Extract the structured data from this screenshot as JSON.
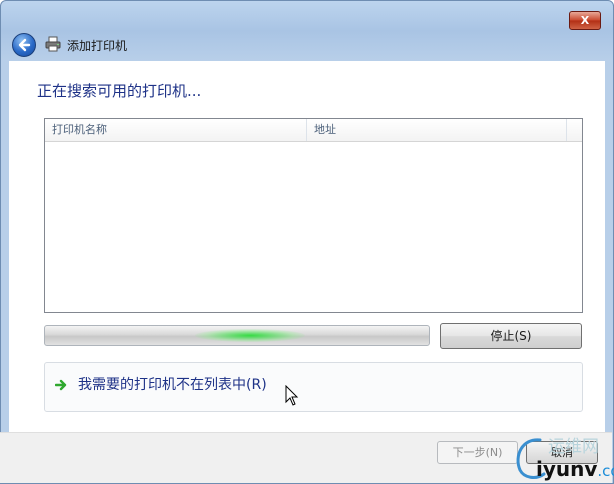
{
  "window": {
    "title": "添加打印机",
    "close_label": "X"
  },
  "main": {
    "heading": "正在搜索可用的打印机...",
    "list": {
      "columns": [
        "打印机名称",
        "地址"
      ],
      "rows": []
    },
    "progress": {
      "state": "indeterminate"
    },
    "stop_label": "停止(S)",
    "missing_printer_link": "我需要的打印机不在列表中(R)"
  },
  "footer": {
    "next_label": "下一步(N)",
    "cancel_label": "取消"
  },
  "watermark": {
    "line1": "运维网",
    "line2_domain": "iyunv",
    "line2_tld": ".com"
  },
  "colors": {
    "accent": "#1e3287",
    "progress_glow": "#2ddc3c",
    "close": "#c9462c"
  },
  "icons": [
    "back-arrow-icon",
    "printer-icon",
    "close-icon",
    "green-arrow-icon",
    "mouse-cursor-icon"
  ]
}
